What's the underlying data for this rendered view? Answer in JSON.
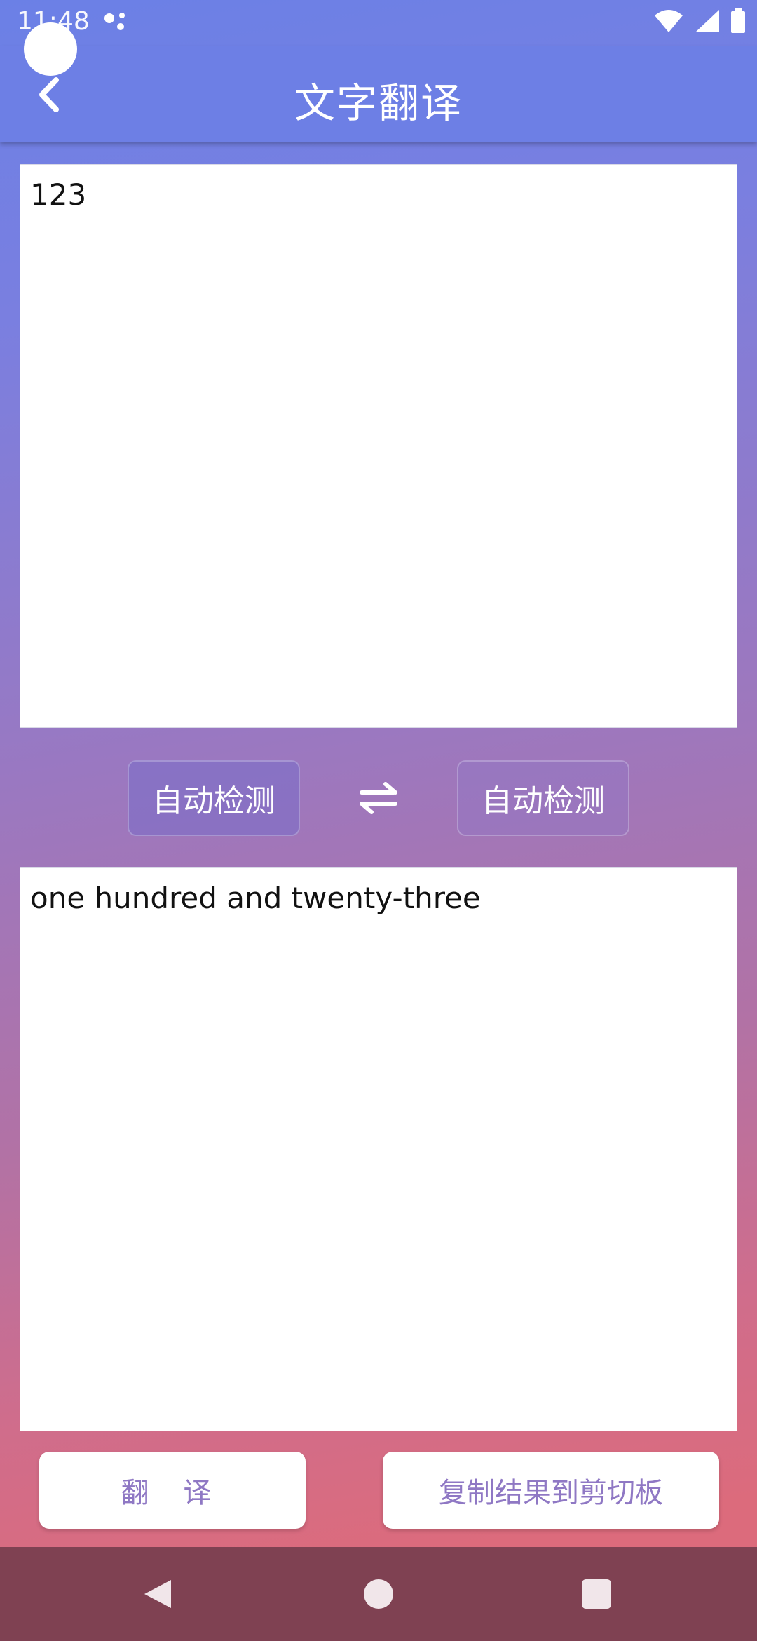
{
  "status_bar": {
    "time": "11:48"
  },
  "app_bar": {
    "title": "文字翻译"
  },
  "source": {
    "text": "123"
  },
  "languages": {
    "source_label": "自动检测",
    "target_label": "自动检测"
  },
  "result": {
    "text": "one hundred and twenty-three"
  },
  "actions": {
    "translate_label": "翻 译",
    "copy_label": "复制结果到剪切板"
  },
  "colors": {
    "gradient_top": "#6b80e6",
    "gradient_bottom": "#dc6b7c",
    "button_text": "#8f78c4",
    "nav_bar": "#7f4152"
  }
}
